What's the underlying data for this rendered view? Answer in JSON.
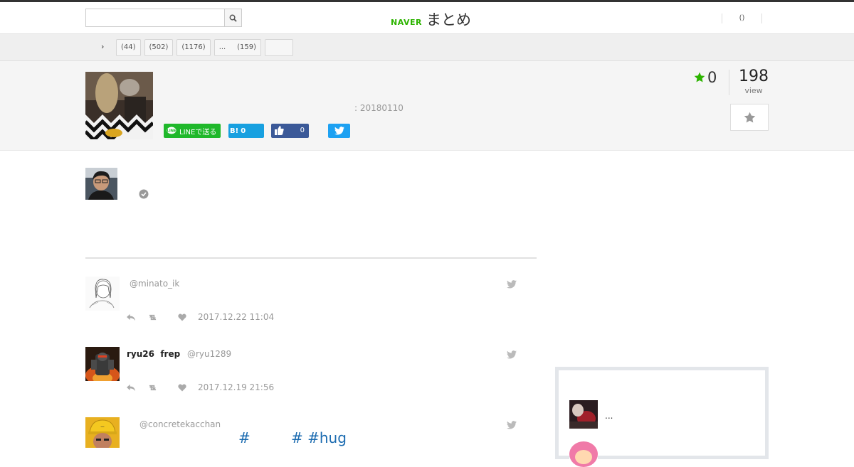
{
  "header": {
    "search_placeholder": "",
    "logo_brand": "NAVER",
    "logo_title": "まとめ",
    "links_text": "()"
  },
  "breadcrumb": {
    "home_label": "",
    "separator": "›",
    "tags": [
      {
        "label": "(44)"
      },
      {
        "label": "(502)"
      },
      {
        "label": "(1176)"
      },
      {
        "label": "...",
        "count": "(159)"
      },
      {
        "label": ""
      }
    ]
  },
  "article": {
    "date": ": 20180110",
    "favorites": "0",
    "views": "198",
    "views_label": "view",
    "share": {
      "line_label": "LINEで送る",
      "hatena_label": "B!",
      "hatena_count": "0",
      "facebook_count": "0"
    }
  },
  "tweets": [
    {
      "name": "",
      "handle": "@minato_ik",
      "time": "2017.12.22 11:04",
      "body": ""
    },
    {
      "name": "ryu26  frep",
      "handle": "@ryu1289",
      "time": "2017.12.19 21:56",
      "body": ""
    },
    {
      "name": "",
      "handle": "@concretekacchan",
      "time": "",
      "body": "#         # #hug"
    }
  ],
  "sidebar": {
    "items": [
      {
        "text": "..."
      },
      {
        "text": ""
      }
    ]
  },
  "colors": {
    "naver_green": "#2db400",
    "line_green": "#1fb82a",
    "hatena_blue": "#17a0e0",
    "facebook_blue": "#3b5998",
    "twitter_blue": "#1da1f2",
    "hashtag_blue": "#1b6bb0"
  }
}
